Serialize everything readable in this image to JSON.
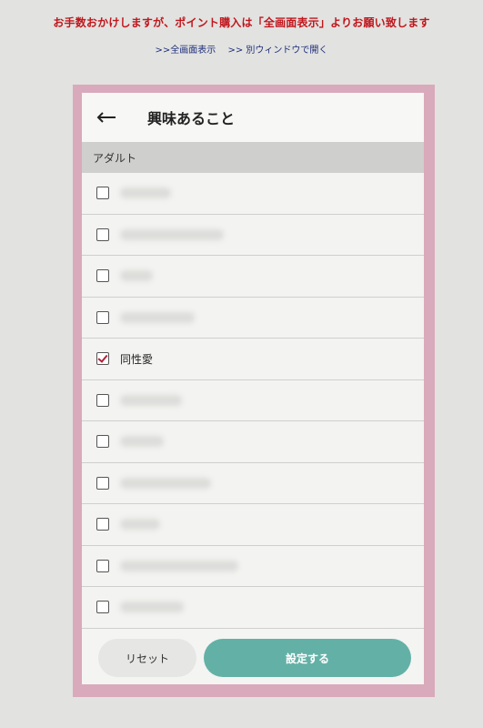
{
  "notice": "お手数おかけしますが、ポイント購入は「全画面表示」よりお願い致します",
  "links": {
    "fullscreen": ">>全画面表示",
    "new_window": ">> 別ウィンドウで開く"
  },
  "header": {
    "back_icon": "left-arrow-icon",
    "title": "興味あること"
  },
  "section": {
    "title": "アダルト"
  },
  "items": [
    {
      "label": "",
      "checked": false,
      "blurred": true
    },
    {
      "label": "",
      "checked": false,
      "blurred": true
    },
    {
      "label": "",
      "checked": false,
      "blurred": true
    },
    {
      "label": "",
      "checked": false,
      "blurred": true
    },
    {
      "label": "同性愛",
      "checked": true,
      "blurred": false
    },
    {
      "label": "",
      "checked": false,
      "blurred": true
    },
    {
      "label": "",
      "checked": false,
      "blurred": true
    },
    {
      "label": "",
      "checked": false,
      "blurred": true
    },
    {
      "label": "",
      "checked": false,
      "blurred": true
    },
    {
      "label": "",
      "checked": false,
      "blurred": true
    },
    {
      "label": "",
      "checked": false,
      "blurred": true
    }
  ],
  "footer": {
    "reset_label": "リセット",
    "submit_label": "設定する"
  },
  "colors": {
    "notice": "#c0161c",
    "frame": "#d9aabb",
    "accent_button": "#63b1a6",
    "check": "#b2203a"
  }
}
